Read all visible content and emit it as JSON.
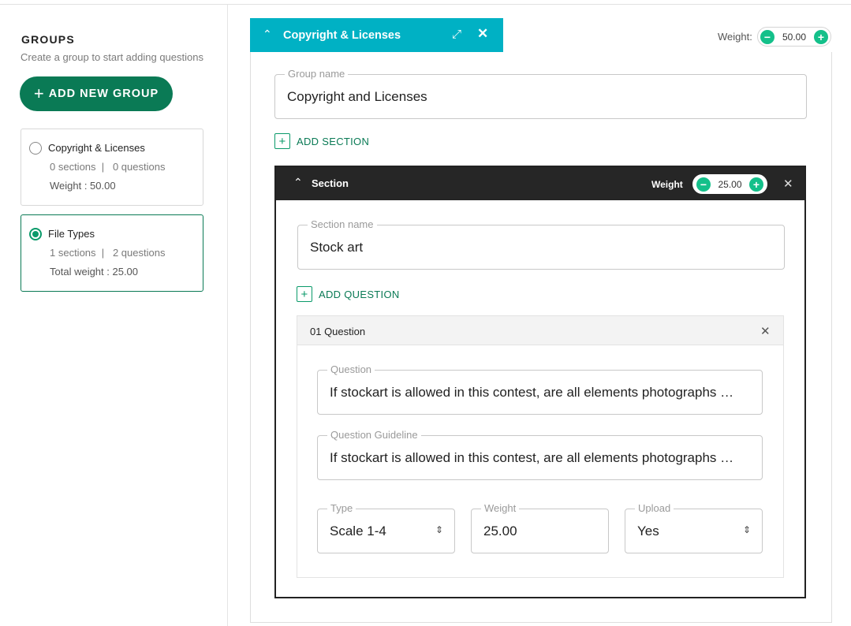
{
  "sidebar": {
    "title": "GROUPS",
    "subtitle": "Create a group to start adding questions",
    "add_button": "ADD NEW GROUP",
    "groups": [
      {
        "name": "Copyright & Licenses",
        "meta": "0 sections  |   0 questions",
        "weight": "Weight : 50.00",
        "selected": false
      },
      {
        "name": "File Types",
        "meta": "1 sections  |   2 questions",
        "weight": "Total weight : 25.00",
        "selected": true
      }
    ]
  },
  "group_tab": {
    "title": "Copyright & Licenses",
    "weight_label": "Weight:",
    "weight_value": "50.00"
  },
  "group_form": {
    "name_label": "Group name",
    "name_value": "Copyright and Licenses",
    "add_section": "ADD SECTION"
  },
  "section": {
    "title": "Section",
    "weight_label": "Weight",
    "weight_value": "25.00",
    "name_label": "Section name",
    "name_value": "Stock art",
    "add_question": "ADD QUESTION"
  },
  "question": {
    "title": "01 Question",
    "question_label": "Question",
    "question_value": "If stockart is allowed in this contest, are all elements photographs …",
    "guideline_label": "Question Guideline",
    "guideline_value": "If stockart is allowed in this contest, are all elements photographs …",
    "type_label": "Type",
    "type_value": "Scale 1-4",
    "weight_label": "Weight",
    "weight_value": "25.00",
    "upload_label": "Upload",
    "upload_value": "Yes"
  },
  "colors": {
    "primary_green": "#0a7a55",
    "accent_green": "#14c08a",
    "tab_cyan": "#00b1c4",
    "section_dark": "#262626"
  }
}
